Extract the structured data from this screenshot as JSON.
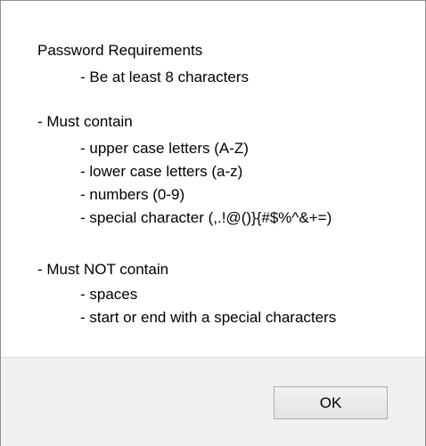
{
  "dialog": {
    "lines": [
      "Password Requirements",
      "- Be at least 8 characters",
      "- Must contain",
      "- upper case letters (A-Z)",
      "- lower case letters (a-z)",
      "- numbers (0-9)",
      "- special character (,.!@()}{#$%^&+=)",
      "- Must NOT contain",
      "- spaces",
      "- start or end with a special characters"
    ],
    "ok_label": "OK"
  }
}
